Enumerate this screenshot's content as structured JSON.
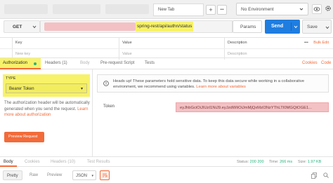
{
  "tabs": {
    "new_tab": "New Tab",
    "add": "+",
    "more": "•••"
  },
  "environment": {
    "selected": "No Environment"
  },
  "request": {
    "method": "GET",
    "url_visible": "spring-rest/api/authn/status",
    "params_label": "Params",
    "send_label": "Send",
    "save_label": "Save"
  },
  "params_table": {
    "headers": [
      "Key",
      "Value",
      "Description"
    ],
    "placeholders": [
      "New key",
      "Value",
      "Description"
    ],
    "more": "•••",
    "bulk_edit": "Bulk Edit"
  },
  "request_tabs": {
    "authorization": "Authorization",
    "headers": "Headers (1)",
    "body": "Body",
    "pre_request": "Pre-request Script",
    "tests": "Tests",
    "cookies": "Cookies",
    "code": "Code"
  },
  "auth": {
    "type_label": "TYPE",
    "type_value": "Bearer Token",
    "description": "The authorization header will be automatically generated when you send the request.",
    "learn_more": "Learn more about authorization",
    "preview_button": "Preview Request",
    "notice": "Heads up! These parameters hold sensitive data. To keep this data secure while working in a collaborative environment, we recommend using variables.",
    "notice_link": "Learn more about variables",
    "token_label": "Token",
    "token_value": "eyJhbGciOiJIUzI1NiJ9.eyJzdWIiOiJmMjQxMzI3NzYThLTI0MGQtOGE1..."
  },
  "response_tabs": {
    "body": "Body",
    "cookies": "Cookies",
    "headers": "Headers (10)",
    "test_results": "Test Results",
    "status_label": "Status:",
    "status_value": "200 200",
    "time_label": "Time:",
    "time_value": "266 ms",
    "size_label": "Size:",
    "size_value": "1.97 KB"
  },
  "response_toolbar": {
    "pretty": "Pretty",
    "raw": "Raw",
    "preview": "Preview",
    "format": "JSON"
  },
  "colors": {
    "accent": "#f26b3a",
    "send_blue": "#1f7de0",
    "highlight_yellow": "#f7f26a",
    "redaction_pink": "#f3c1c4",
    "status_green": "#26b47f"
  }
}
